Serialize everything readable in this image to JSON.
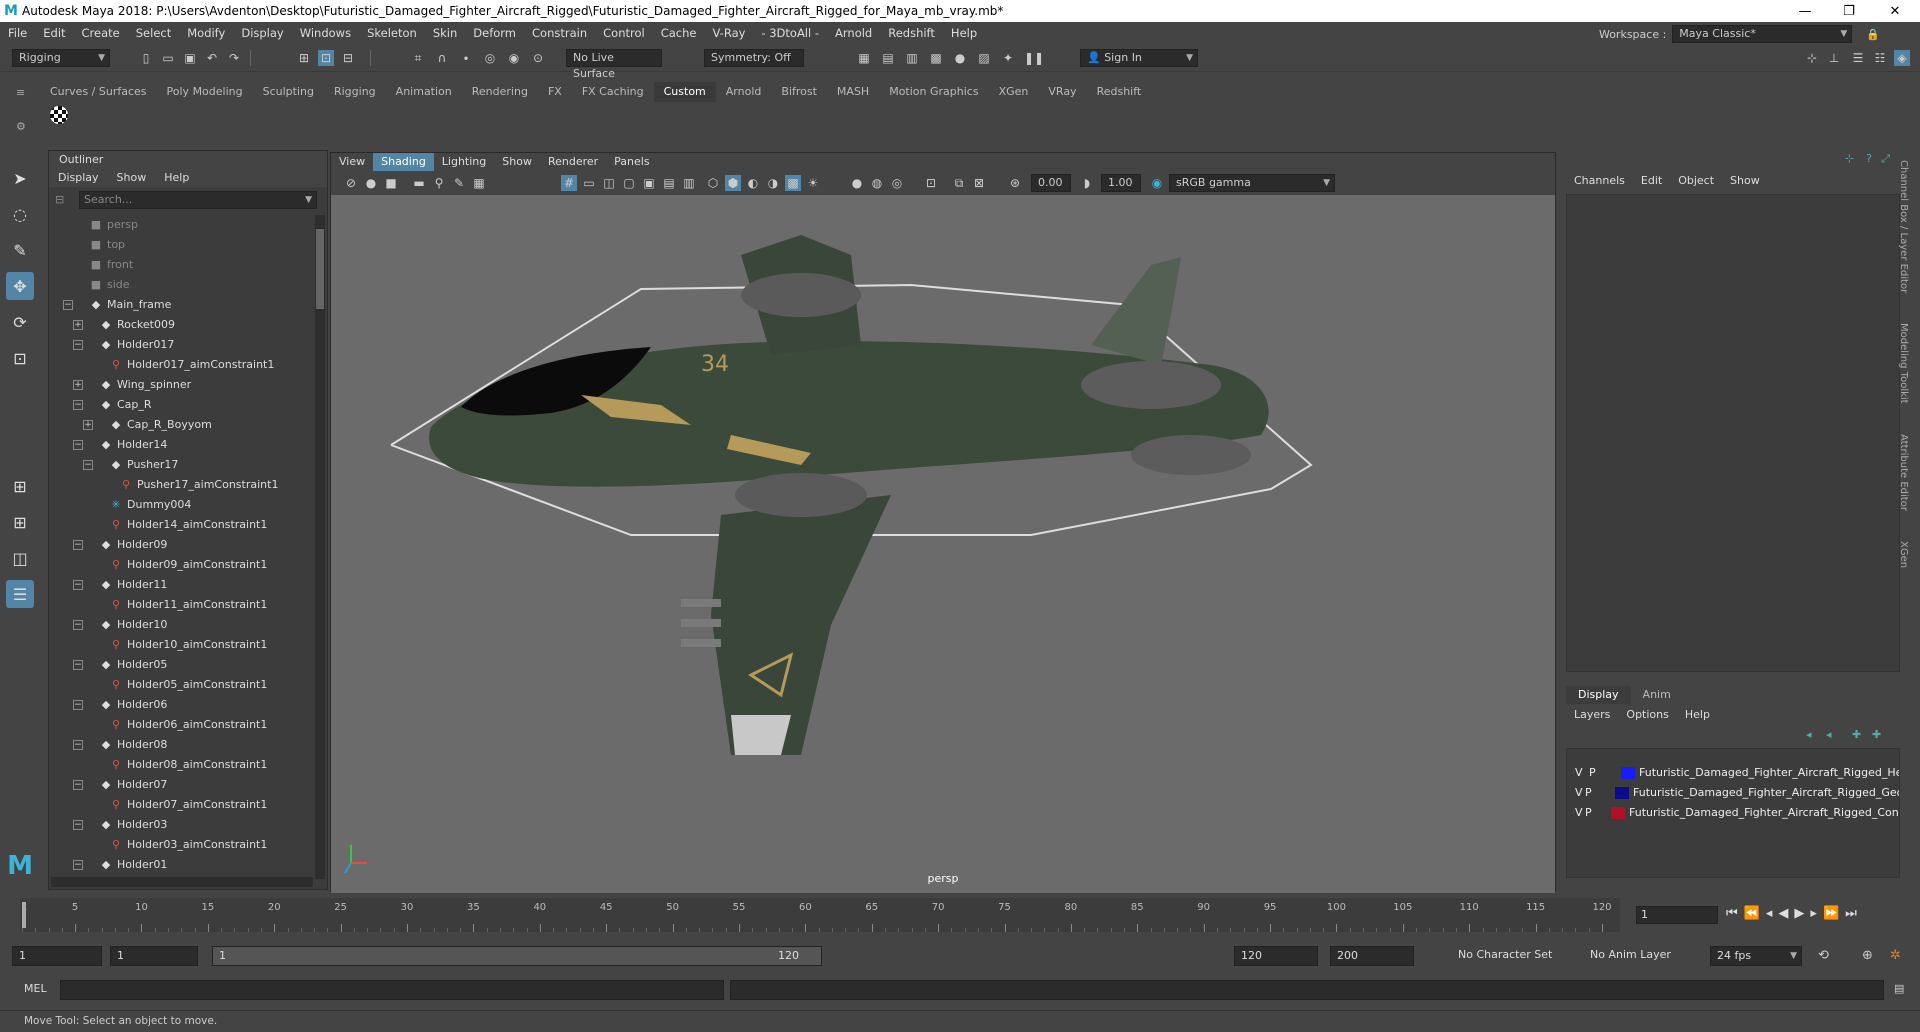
{
  "window": {
    "title": "Autodesk Maya 2018: P:\\Users\\Avdenton\\Desktop\\Futuristic_Damaged_Fighter_Aircraft_Rigged\\Futuristic_Damaged_Fighter_Aircraft_Rigged_for_Maya_mb_vray.mb*",
    "logo": "M",
    "minimize": "—",
    "maximize": "❐",
    "close": "✕"
  },
  "menubar": {
    "items": [
      "File",
      "Edit",
      "Create",
      "Select",
      "Modify",
      "Display",
      "Windows",
      "Skeleton",
      "Skin",
      "Deform",
      "Constrain",
      "Control",
      "Cache",
      "V-Ray",
      "- 3DtoAll -",
      "Arnold",
      "Redshift",
      "Help"
    ],
    "workspace_label": "Workspace :",
    "workspace_value": "Maya Classic*"
  },
  "statusline": {
    "mode": "Rigging",
    "live_surface": "No Live Surface",
    "symmetry": "Symmetry: Off",
    "sign_in": "Sign In"
  },
  "shelf": {
    "tabs": [
      "Curves / Surfaces",
      "Poly Modeling",
      "Sculpting",
      "Rigging",
      "Animation",
      "Rendering",
      "FX",
      "FX Caching",
      "Custom",
      "Arnold",
      "Bifrost",
      "MASH",
      "Motion Graphics",
      "XGen",
      "VRay",
      "Redshift"
    ],
    "active": "Custom"
  },
  "outliner": {
    "title": "Outliner",
    "menu": [
      "Display",
      "Show",
      "Help"
    ],
    "search_placeholder": "Search...",
    "rows": [
      {
        "label": "persp",
        "type": "cam",
        "depth": 0,
        "exp": ""
      },
      {
        "label": "top",
        "type": "cam",
        "depth": 0,
        "exp": ""
      },
      {
        "label": "front",
        "type": "cam",
        "depth": 0,
        "exp": ""
      },
      {
        "label": "side",
        "type": "cam",
        "depth": 0,
        "exp": ""
      },
      {
        "label": "Main_frame",
        "type": "tf",
        "depth": 0,
        "exp": "−"
      },
      {
        "label": "Rocket009",
        "type": "tf",
        "depth": 1,
        "exp": "+"
      },
      {
        "label": "Holder017",
        "type": "tf",
        "depth": 1,
        "exp": "−"
      },
      {
        "label": "Holder017_aimConstraint1",
        "type": "cons",
        "depth": 2,
        "exp": ""
      },
      {
        "label": "Wing_spinner",
        "type": "tf",
        "depth": 1,
        "exp": "+"
      },
      {
        "label": "Cap_R",
        "type": "tf",
        "depth": 1,
        "exp": "−"
      },
      {
        "label": "Cap_R_Boyyom",
        "type": "tf",
        "depth": 2,
        "exp": "+"
      },
      {
        "label": "Holder14",
        "type": "tf",
        "depth": 1,
        "exp": "−"
      },
      {
        "label": "Pusher17",
        "type": "tf",
        "depth": 2,
        "exp": "−"
      },
      {
        "label": "Pusher17_aimConstraint1",
        "type": "cons",
        "depth": 3,
        "exp": ""
      },
      {
        "label": "Dummy004",
        "type": "dummy",
        "depth": 2,
        "exp": ""
      },
      {
        "label": "Holder14_aimConstraint1",
        "type": "cons",
        "depth": 2,
        "exp": ""
      },
      {
        "label": "Holder09",
        "type": "tf",
        "depth": 1,
        "exp": "−"
      },
      {
        "label": "Holder09_aimConstraint1",
        "type": "cons",
        "depth": 2,
        "exp": ""
      },
      {
        "label": "Holder11",
        "type": "tf",
        "depth": 1,
        "exp": "−"
      },
      {
        "label": "Holder11_aimConstraint1",
        "type": "cons",
        "depth": 2,
        "exp": ""
      },
      {
        "label": "Holder10",
        "type": "tf",
        "depth": 1,
        "exp": "−"
      },
      {
        "label": "Holder10_aimConstraint1",
        "type": "cons",
        "depth": 2,
        "exp": ""
      },
      {
        "label": "Holder05",
        "type": "tf",
        "depth": 1,
        "exp": "−"
      },
      {
        "label": "Holder05_aimConstraint1",
        "type": "cons",
        "depth": 2,
        "exp": ""
      },
      {
        "label": "Holder06",
        "type": "tf",
        "depth": 1,
        "exp": "−"
      },
      {
        "label": "Holder06_aimConstraint1",
        "type": "cons",
        "depth": 2,
        "exp": ""
      },
      {
        "label": "Holder08",
        "type": "tf",
        "depth": 1,
        "exp": "−"
      },
      {
        "label": "Holder08_aimConstraint1",
        "type": "cons",
        "depth": 2,
        "exp": ""
      },
      {
        "label": "Holder07",
        "type": "tf",
        "depth": 1,
        "exp": "−"
      },
      {
        "label": "Holder07_aimConstraint1",
        "type": "cons",
        "depth": 2,
        "exp": ""
      },
      {
        "label": "Holder03",
        "type": "tf",
        "depth": 1,
        "exp": "−"
      },
      {
        "label": "Holder03_aimConstraint1",
        "type": "cons",
        "depth": 2,
        "exp": ""
      },
      {
        "label": "Holder01",
        "type": "tf",
        "depth": 1,
        "exp": "−"
      }
    ]
  },
  "viewport": {
    "menu": [
      "View",
      "Shading",
      "Lighting",
      "Show",
      "Renderer",
      "Panels"
    ],
    "active_menu": "Shading",
    "field1": "0.00",
    "field2": "1.00",
    "colorspace": "sRGB gamma",
    "camera_label": "persp",
    "decal_number": "34"
  },
  "channelbox": {
    "menu": [
      "Channels",
      "Edit",
      "Object",
      "Show"
    ],
    "layer_tabs": [
      "Display",
      "Anim"
    ],
    "active_tab": "Display",
    "layer_menu": [
      "Layers",
      "Options",
      "Help"
    ],
    "layers": [
      {
        "v": "V",
        "p": "P",
        "color": "#1a1aff",
        "name": "Futuristic_Damaged_Fighter_Aircraft_Rigged_Hel"
      },
      {
        "v": "V",
        "p": "P",
        "color": "#0b0b8c",
        "name": "Futuristic_Damaged_Fighter_Aircraft_Rigged_Geom"
      },
      {
        "v": "V",
        "p": "P",
        "color": "#b0102a",
        "name": "Futuristic_Damaged_Fighter_Aircraft_Rigged_Contro"
      }
    ],
    "side_tabs": [
      "Channel Box / Layer Editor",
      "Modeling Toolkit",
      "Attribute Editor",
      "XGen"
    ]
  },
  "timeline": {
    "ticks": [
      5,
      10,
      15,
      20,
      25,
      30,
      35,
      40,
      45,
      50,
      55,
      60,
      65,
      70,
      75,
      80,
      85,
      90,
      95,
      100,
      105,
      110,
      115,
      120
    ],
    "start_tick": "1",
    "current_frame": "1"
  },
  "range": {
    "start": "1",
    "playback_start": "1",
    "slider_start": "1",
    "slider_end": "120",
    "playback_end": "120",
    "end": "200",
    "character_set": "No Character Set",
    "anim_layer": "No Anim Layer",
    "fps": "24 fps"
  },
  "cmdline": {
    "label": "MEL"
  },
  "helpline": {
    "text": "Move Tool: Select an object to move."
  }
}
